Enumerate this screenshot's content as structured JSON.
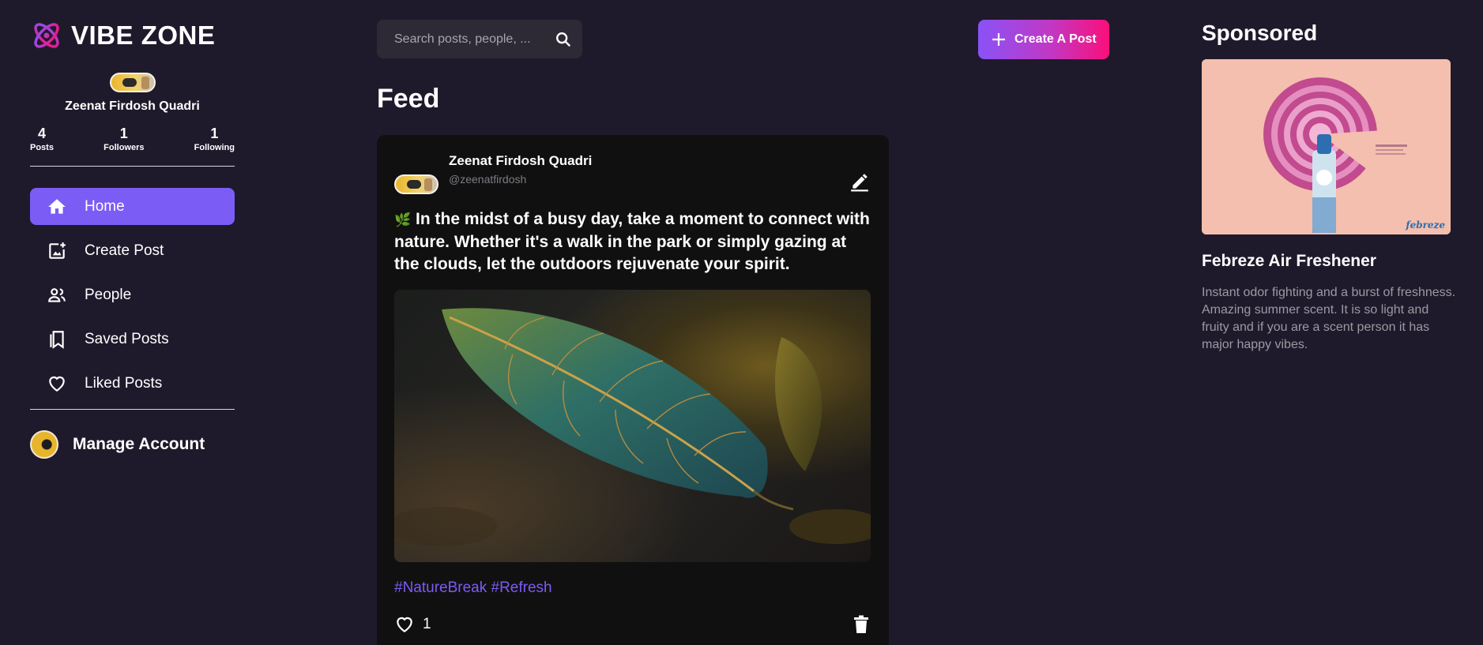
{
  "brand": {
    "name": "VIBE ZONE"
  },
  "profile": {
    "name": "Zeenat Firdosh Quadri",
    "stats": [
      {
        "value": "4",
        "label": "Posts"
      },
      {
        "value": "1",
        "label": "Followers"
      },
      {
        "value": "1",
        "label": "Following"
      }
    ]
  },
  "nav": {
    "items": [
      {
        "label": "Home",
        "icon": "home-icon",
        "active": true
      },
      {
        "label": "Create Post",
        "icon": "add-photo-icon",
        "active": false
      },
      {
        "label": "People",
        "icon": "people-icon",
        "active": false
      },
      {
        "label": "Saved Posts",
        "icon": "bookmarks-icon",
        "active": false
      },
      {
        "label": "Liked Posts",
        "icon": "heart-icon",
        "active": false
      }
    ]
  },
  "manage": {
    "label": "Manage Account"
  },
  "search": {
    "placeholder": "Search posts, people, ..."
  },
  "create_button": {
    "label": "Create A Post"
  },
  "feed": {
    "title": "Feed",
    "post": {
      "author": "Zeenat Firdosh Quadri",
      "handle": "@zeenatfirdosh",
      "emoji": "🌿",
      "text": "In the midst of a busy day, take a moment to connect with nature. Whether it's a walk in the park or simply gazing at the clouds, let the outdoors rejuvenate your spirit.",
      "tags": "#NatureBreak #Refresh",
      "likes": "1"
    }
  },
  "sponsored": {
    "title": "Sponsored",
    "ad_name": "Febreze Air Freshener",
    "ad_desc": "Instant odor fighting and a burst of freshness. Amazing summer scent. It is so light and fruity and if you are a scent person it has major happy vibes.",
    "ad_brand": "febreze"
  },
  "colors": {
    "background": "#1f1a2b",
    "accent": "#7b5cf5",
    "card": "#111011",
    "gradient_start": "#8a52f7",
    "gradient_end": "#fb0f7a"
  }
}
